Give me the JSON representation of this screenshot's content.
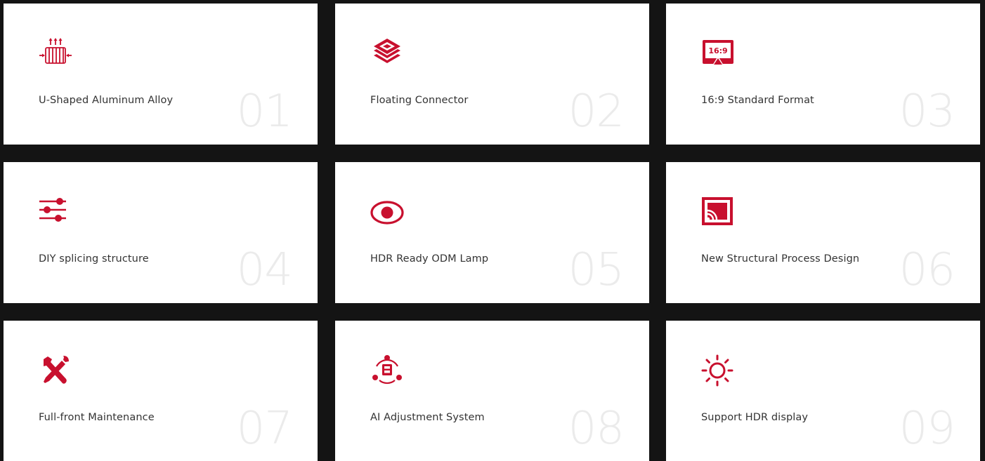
{
  "accent_color": "#c8102e",
  "features": [
    {
      "label": "U-Shaped Aluminum Alloy",
      "number": "01",
      "icon": "heat-dissipation-icon"
    },
    {
      "label": "Floating Connector",
      "number": "02",
      "icon": "layers-icon"
    },
    {
      "label": "16:9 Standard Format",
      "number": "03",
      "icon": "aspect-ratio-icon",
      "icon_text": "16:9"
    },
    {
      "label": "DIY splicing structure",
      "number": "04",
      "icon": "sliders-icon"
    },
    {
      "label": "HDR Ready ODM Lamp",
      "number": "05",
      "icon": "eye-icon"
    },
    {
      "label": "New Structural Process Design",
      "number": "06",
      "icon": "cast-icon"
    },
    {
      "label": "Full-front Maintenance",
      "number": "07",
      "icon": "tools-icon"
    },
    {
      "label": "AI Adjustment System",
      "number": "08",
      "icon": "ai-system-icon"
    },
    {
      "label": "Support HDR display",
      "number": "09",
      "icon": "sun-icon"
    }
  ]
}
